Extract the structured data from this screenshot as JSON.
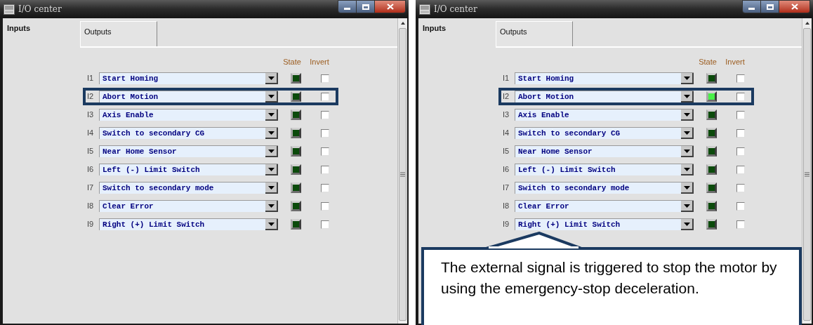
{
  "windows": [
    {
      "title": "I/O center",
      "tabs": [
        {
          "label": "Inputs",
          "selected": true
        },
        {
          "label": "Outputs",
          "selected": false
        }
      ],
      "columns": [
        "State",
        "Invert"
      ],
      "rows": [
        {
          "label": "I1",
          "value": "Start Homing",
          "on": false,
          "invert": false,
          "highlighted": false
        },
        {
          "label": "I2",
          "value": "Abort Motion",
          "on": false,
          "invert": false,
          "highlighted": true
        },
        {
          "label": "I3",
          "value": "Axis Enable",
          "on": false,
          "invert": false,
          "highlighted": false
        },
        {
          "label": "I4",
          "value": "Switch to secondary CG",
          "on": false,
          "invert": false,
          "highlighted": false
        },
        {
          "label": "I5",
          "value": "Near Home Sensor",
          "on": false,
          "invert": false,
          "highlighted": false
        },
        {
          "label": "I6",
          "value": "Left (-) Limit Switch",
          "on": false,
          "invert": false,
          "highlighted": false
        },
        {
          "label": "I7",
          "value": "Switch to secondary mode",
          "on": false,
          "invert": false,
          "highlighted": false
        },
        {
          "label": "I8",
          "value": "Clear Error",
          "on": false,
          "invert": false,
          "highlighted": false
        },
        {
          "label": "I9",
          "value": "Right (+) Limit Switch",
          "on": false,
          "invert": false,
          "highlighted": false
        }
      ]
    },
    {
      "title": "I/O center",
      "tabs": [
        {
          "label": "Inputs",
          "selected": true
        },
        {
          "label": "Outputs",
          "selected": false
        }
      ],
      "columns": [
        "State",
        "Invert"
      ],
      "rows": [
        {
          "label": "I1",
          "value": "Start Homing",
          "on": false,
          "invert": false,
          "highlighted": false
        },
        {
          "label": "I2",
          "value": "Abort Motion",
          "on": true,
          "invert": false,
          "highlighted": true
        },
        {
          "label": "I3",
          "value": "Axis Enable",
          "on": false,
          "invert": false,
          "highlighted": false
        },
        {
          "label": "I4",
          "value": "Switch to secondary CG",
          "on": false,
          "invert": false,
          "highlighted": false
        },
        {
          "label": "I5",
          "value": "Near Home Sensor",
          "on": false,
          "invert": false,
          "highlighted": false
        },
        {
          "label": "I6",
          "value": "Left (-) Limit Switch",
          "on": false,
          "invert": false,
          "highlighted": false
        },
        {
          "label": "I7",
          "value": "Switch to secondary mode",
          "on": false,
          "invert": false,
          "highlighted": false
        },
        {
          "label": "I8",
          "value": "Clear Error",
          "on": false,
          "invert": false,
          "highlighted": false
        },
        {
          "label": "I9",
          "value": "Right (+) Limit Switch",
          "on": false,
          "invert": false,
          "highlighted": false
        }
      ],
      "callout": "The external signal is triggered to stop the motor by using the emergency-stop deceleration."
    }
  ]
}
